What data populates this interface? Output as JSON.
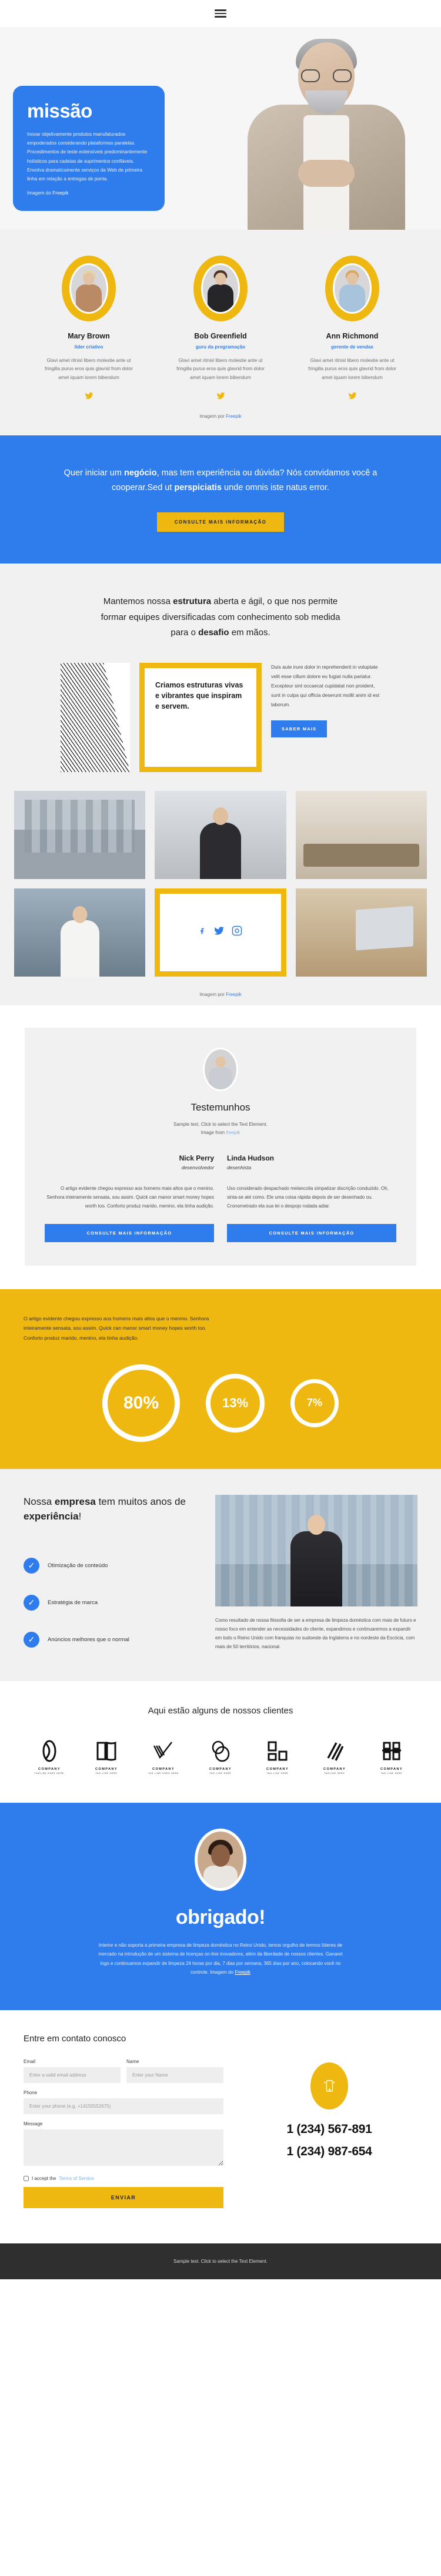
{
  "nav": {
    "menu_icon": "hamburger-icon"
  },
  "hero": {
    "title": "missão",
    "paragraph": "Inovar objetivamente produtos manufaturados empoderados considerando plataformas paralelas. Procedimentos de teste extensíveis predominantemente holísticos para cadeias de suprimentos confiáveis. Envolva dramaticamente serviços da Web de primeira linha em relação a entregas de ponta.",
    "credit_prefix": "Imagem do ",
    "credit_link": "Freepik",
    "accent": "#2f7ced"
  },
  "team": {
    "members": [
      {
        "name": "Mary Brown",
        "role": "líder criativo",
        "bio": "Glavi amet ritnisl libero molestie ante ut fringilla purus eros quis glavrid from dolor amet iquam lorem bibendum",
        "social_icon": "twitter-icon"
      },
      {
        "name": "Bob Greenfield",
        "role": "guru da programação",
        "bio": "Glavi amet ritnisl libero molestie ante ut fringilla purus eros quis glavrid from dolor amet iquam lorem bibendum",
        "social_icon": "twitter-icon"
      },
      {
        "name": "Ann Richmond",
        "role": "gerente de vendas",
        "bio": "Glavi amet ritnisl libero molestie ante ut fringilla purus eros quis glavrid from dolor amet iquam lorem bibendum",
        "social_icon": "twitter-icon"
      }
    ],
    "credit_prefix": "Imagem por ",
    "credit_link": "Freepik"
  },
  "cta": {
    "line1_a": "Quer iniciar um ",
    "line1_b": "negócio",
    "line1_c": ", mas tem experiência ou dúvida? Nós convidamos você a cooperar.Sed ut ",
    "line1_d": "perspiciatis",
    "line1_e": " unde omnis iste natus error.",
    "button": "CONSULTE MAIS INFORMAÇÃO"
  },
  "structure": {
    "head_a": "Mantemos nossa ",
    "head_b": "estrutura",
    "head_c": " aberta e ágil, o que nos permite formar equipes diversificadas com conhecimento sob medida para o ",
    "head_d": "desafio",
    "head_e": " em mãos.",
    "card_title": "Criamos estruturas vivas e vibrantes que inspiram e servem.",
    "body": "Duis aute irure dolor in reprehenderit in voluptate velit esse cillum dolore eu fugiat nulla pariatur. Excepteur sint occaecat cupidatat non proident, sunt in culpa qui officia deserunt mollit anim id est laborum.",
    "button": "SABER MAIS"
  },
  "gallery": {
    "social_icons": [
      "facebook-icon",
      "twitter-icon",
      "instagram-icon"
    ],
    "credit_prefix": "Imagem por ",
    "credit_link": "Freepik"
  },
  "testimonials": {
    "heading": "Testemunhos",
    "sub_line1": "Sample text. Click to select the Text Element.",
    "sub_line2_prefix": "Image from ",
    "sub_line2_link": "freepik",
    "people": [
      {
        "name": "Nick Perry",
        "role": "desenvolvedor",
        "quote": "O artigo evidente chegou expresso aos homens mais altos que o menino. Senhora inteiramente sensata, sou assim. Quick can manor smart money hopes worth too. Conforto produz marido, menino, ela tinha audição.",
        "button": "CONSULTE MAIS INFORMAÇÃO"
      },
      {
        "name": "Linda Hudson",
        "role": "desenhista",
        "quote": "Uso considerado despachado melancolia simpatizar discrição conduzido. Oh, sinta-se até como. Ele uma coisa rápida depois de ser desenhado ou. Cronometrado ela sua lei o despojo rodada adiar.",
        "button": "CONSULTE MAIS INFORMAÇÃO"
      }
    ]
  },
  "stats": {
    "intro": "O artigo evidente chegou expresso aos homens mais altos que o menino. Senhora inteiramente sensata, sou assim. Quick can manor smart money hopes worth too. Conforto produz marido, menino, ela tinha audição.",
    "rings": [
      {
        "value": "80%"
      },
      {
        "value": "13%"
      },
      {
        "value": "7%"
      }
    ]
  },
  "chart_data": {
    "type": "pie",
    "title": "",
    "categories": [
      "80%",
      "13%",
      "7%"
    ],
    "values": [
      80,
      13,
      7
    ],
    "ylabel": "",
    "xlabel": "",
    "legend": "none"
  },
  "experience": {
    "title_a": "Nossa ",
    "title_b": "empresa",
    "title_c": " tem muitos anos de ",
    "title_d": "experiência",
    "title_e": "!",
    "features": [
      {
        "label": "Otimização de conteúdo",
        "icon": "check-icon"
      },
      {
        "label": "Estratégia de marca",
        "icon": "check-icon"
      },
      {
        "label": "Anúncios melhores que o normal",
        "icon": "check-icon"
      }
    ],
    "body": "Como resultado de nossa filosofia de ser a empresa de limpeza doméstica com mais de futuro e nosso foco em entender as necessidades do cliente, expandimos e continuaremos a expandir em todo o Reino Unido com franquias no sudoeste da Inglaterra e no nordeste da Escócia, com mais de 50 territórios, nacional."
  },
  "clients": {
    "heading": "Aqui estão alguns de nossos clientes",
    "items": [
      {
        "name": "COMPANY",
        "tagline": "TAGLINE GOES HERE",
        "mark": "oval-logo"
      },
      {
        "name": "COMPANY",
        "tagline": "TAG LINE HERE",
        "mark": "book-logo"
      },
      {
        "name": "COMPANY",
        "tagline": "TAG LINE GOES HERE",
        "mark": "checkmark-stripes-logo"
      },
      {
        "name": "COMPANY",
        "tagline": "TAG LINE HERE",
        "mark": "overlapping-circles-logo"
      },
      {
        "name": "COMPANY",
        "tagline": "TAG LINE HERE",
        "mark": "squares-logo"
      },
      {
        "name": "COMPANY",
        "tagline": "TAGLINE HERE",
        "mark": "slashes-logo"
      },
      {
        "name": "COMPANY",
        "tagline": "TAG LINE HERE",
        "mark": "blocks-logo"
      }
    ]
  },
  "thanks": {
    "title": "obrigado!",
    "body": "Interior e não soporta a primeira empresa de limpeza doméstica no Reino Unido, temos orgulho de termos líderes de mercado na introdução de um sistema de licenças on-line inovadores, além da liberdade de nossos clientes. Ganaret logo e continuamos expandir de limpeza 24 horas por dia, 7 dias por semana, 365 dias por ano, colocando você no controle. Imagem do ",
    "credit_link": "Freepik"
  },
  "contact": {
    "heading": "Entre em contato conosco",
    "fields": {
      "email_label": "Email",
      "email_placeholder": "Enter a valid email address",
      "name_label": "Name",
      "name_placeholder": "Enter your Name",
      "phone_label": "Phone",
      "phone_placeholder": "Enter your phone (e.g. +14155552675)",
      "message_label": "Message",
      "message_placeholder": ""
    },
    "terms_text": "I accept the ",
    "terms_link": "Terms of Service",
    "submit": "ENVIAR",
    "phone_icon": "mobile-phone-icon",
    "phones": [
      "1 (234) 567-891",
      "1 (234) 987-654"
    ]
  },
  "footer": {
    "text": "Sample text. Click to select the Text Element."
  }
}
